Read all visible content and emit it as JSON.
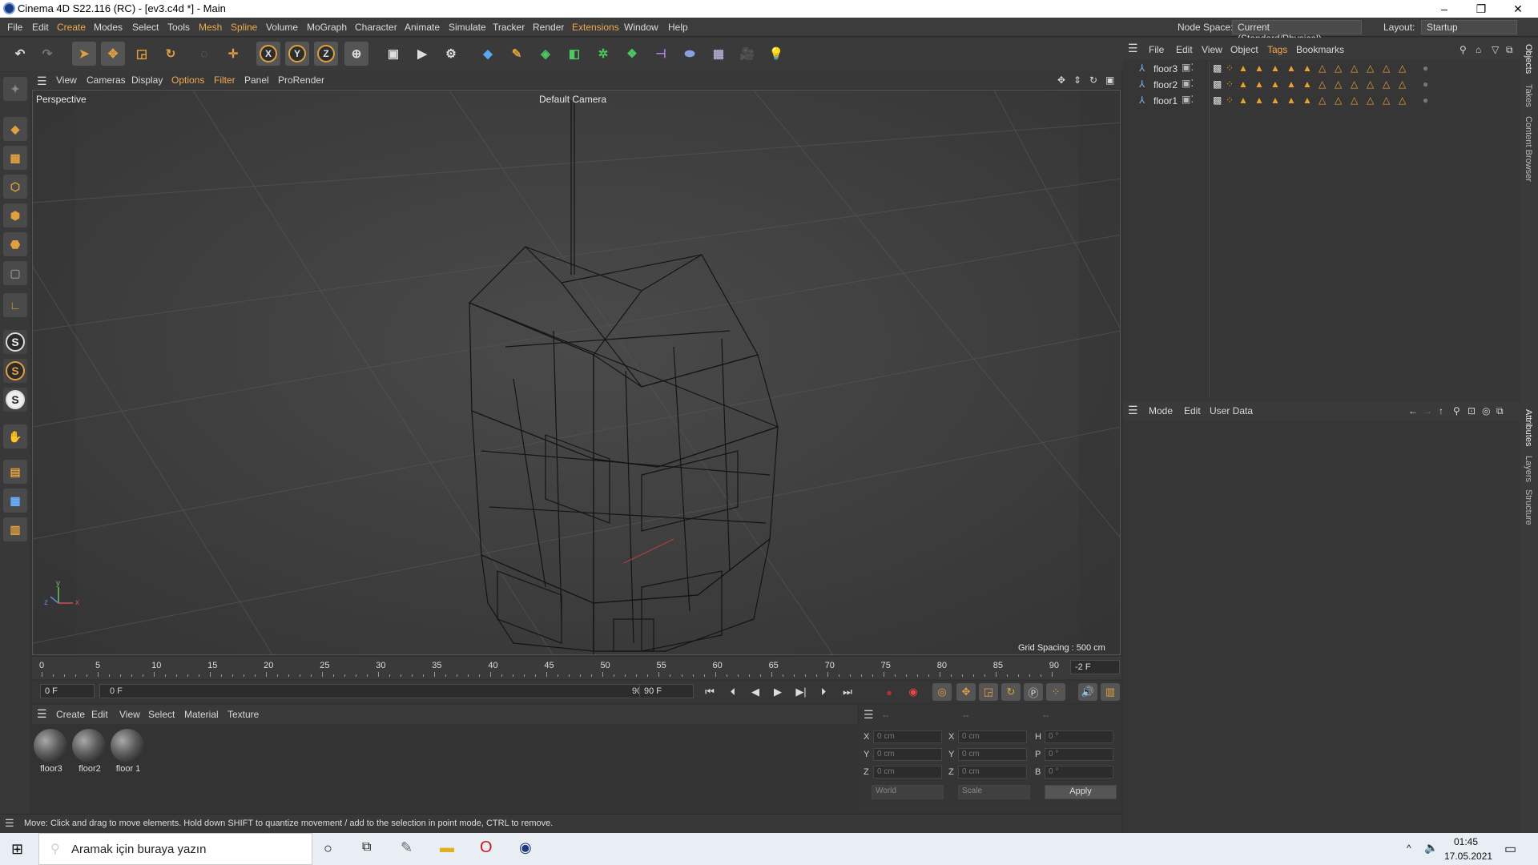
{
  "window": {
    "title": "Cinema 4D S22.116 (RC) - [ev3.c4d *] - Main"
  },
  "menu": {
    "items": [
      "File",
      "Edit",
      "Create",
      "Modes",
      "Select",
      "Tools",
      "Mesh",
      "Spline",
      "Volume",
      "MoGraph",
      "Character",
      "Animate",
      "Simulate",
      "Tracker",
      "Render",
      "Extensions",
      "Window",
      "Help"
    ]
  },
  "nodespace": {
    "label": "Node Space:",
    "value": "Current (Standard/Physical)"
  },
  "layout": {
    "label": "Layout:",
    "value": "Startup"
  },
  "toolbar": {
    "axis_x": "X",
    "axis_y": "Y",
    "axis_z": "Z"
  },
  "viewport": {
    "menu": [
      "View",
      "Cameras",
      "Display",
      "Options",
      "Filter",
      "Panel",
      "ProRender"
    ],
    "name": "Perspective",
    "camera": "Default Camera",
    "grid_spacing": "Grid Spacing : 500 cm",
    "axis_y": "y",
    "axis_z": "z",
    "axis_x": "x"
  },
  "timeline": {
    "ticks": [
      "0",
      "5",
      "10",
      "15",
      "20",
      "25",
      "30",
      "35",
      "40",
      "45",
      "50",
      "55",
      "60",
      "65",
      "70",
      "75",
      "80",
      "85",
      "90"
    ],
    "right_value": "-2 F",
    "start_field": "0 F",
    "range_start": "0 F",
    "range_end": "90 F",
    "end_field": "90 F"
  },
  "materials": {
    "menu": [
      "Create",
      "Edit",
      "View",
      "Select",
      "Material",
      "Texture"
    ],
    "items": [
      "floor3",
      "floor2",
      "floor 1"
    ]
  },
  "coordinates": {
    "headers": [
      "--",
      "--",
      "--"
    ],
    "rows": [
      {
        "a": "X",
        "av": "0 cm",
        "b": "X",
        "bv": "0 cm",
        "c": "H",
        "cv": "0 °"
      },
      {
        "a": "Y",
        "av": "0 cm",
        "b": "Y",
        "bv": "0 cm",
        "c": "P",
        "cv": "0 °"
      },
      {
        "a": "Z",
        "av": "0 cm",
        "b": "Z",
        "bv": "0 cm",
        "c": "B",
        "cv": "0 °"
      }
    ],
    "world": "World",
    "scale": "Scale",
    "apply": "Apply"
  },
  "status": {
    "text": "Move: Click and drag to move elements. Hold down SHIFT to quantize movement / add to the selection in point mode, CTRL to remove."
  },
  "objects": {
    "menu": [
      "File",
      "Edit",
      "View",
      "Object",
      "Tags",
      "Bookmarks"
    ],
    "items": [
      "floor3",
      "floor2",
      "floor1"
    ]
  },
  "attributes": {
    "menu": [
      "Mode",
      "Edit",
      "User Data"
    ]
  },
  "side_tabs": [
    "Objects",
    "Takes",
    "Content Browser",
    "Attributes",
    "Layers",
    "Structure"
  ],
  "taskbar": {
    "search_placeholder": "Aramak için buraya yazın",
    "time": "01:45",
    "date": "17.05.2021"
  },
  "colors": {
    "accent": "#e8a030",
    "background": "#333333",
    "highlight_menu": "#f0a850"
  }
}
